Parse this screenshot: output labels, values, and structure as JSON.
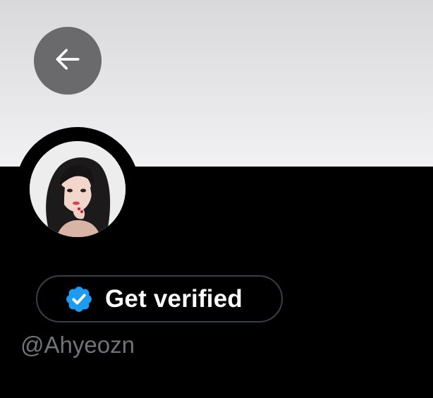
{
  "profile": {
    "handle": "@Ahyeozn",
    "verify_label": "Get verified"
  },
  "icons": {
    "back": "arrow-left-icon",
    "badge": "verified-badge-icon"
  },
  "colors": {
    "banner": "#e4e4e6",
    "page_background": "#000000",
    "back_button": "#6a6a6c",
    "badge": "#1d9bf0",
    "pill_border": "#3a3f44",
    "handle_text": "#707378"
  }
}
